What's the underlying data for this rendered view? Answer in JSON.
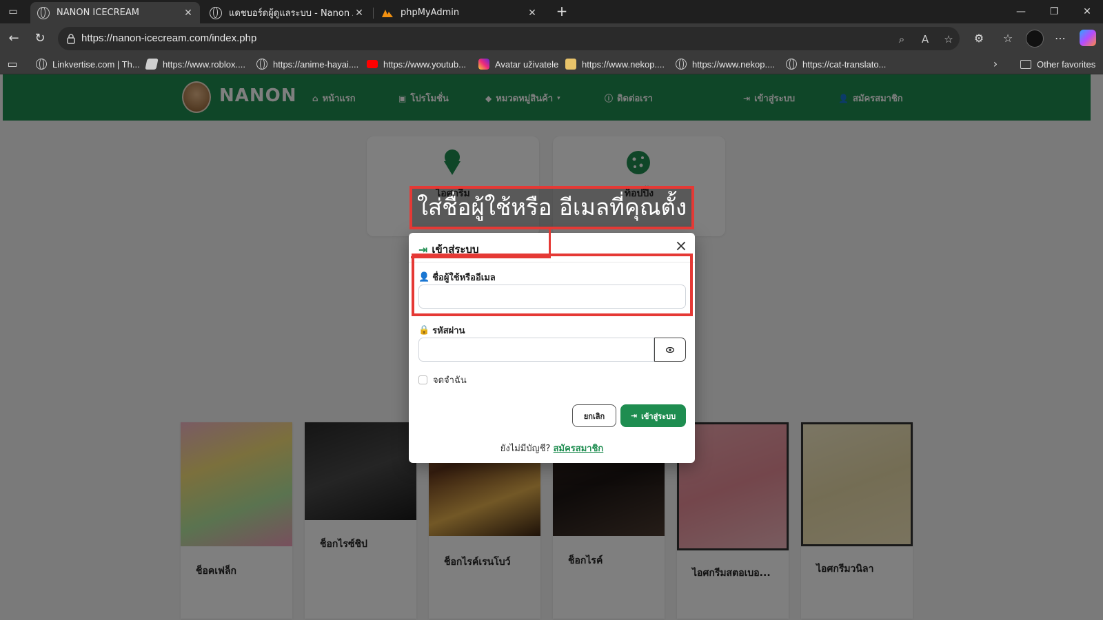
{
  "browser": {
    "tabs": [
      {
        "title": "NANON ICECREAM",
        "active": true
      },
      {
        "title": "แดชบอร์ดผู้ดูแลระบบ - Nanon Admin",
        "active": false
      },
      {
        "title": "phpMyAdmin",
        "active": false
      }
    ],
    "url": "https://nanon-icecream.com/index.php",
    "bookmarks": [
      {
        "label": "Linkvertise.com | Th...",
        "icon": "globe-icon"
      },
      {
        "label": "https://www.roblox....",
        "icon": "roblox-icon"
      },
      {
        "label": "https://anime-hayai....",
        "icon": "globe-icon"
      },
      {
        "label": "https://www.youtub...",
        "icon": "youtube-icon"
      },
      {
        "label": "Avatar uživatele",
        "icon": "instagram-icon"
      },
      {
        "label": "https://www.nekop....",
        "icon": "cat-icon"
      },
      {
        "label": "https://www.nekop....",
        "icon": "globe-icon"
      },
      {
        "label": "https://cat-translato...",
        "icon": "globe-icon"
      }
    ],
    "other_favorites": "Other favorites"
  },
  "site": {
    "brand": "NANON",
    "nav": [
      {
        "label": "หน้าแรก",
        "icon": "home-icon"
      },
      {
        "label": "โปรโมชั่น",
        "icon": "gift-icon"
      },
      {
        "label": "หมวดหมู่สินค้า",
        "icon": "tag-icon"
      },
      {
        "label": "ติดต่อเรา",
        "icon": "info-icon"
      },
      {
        "label": "เข้าสู่ระบบ",
        "icon": "sign-in-icon"
      },
      {
        "label": "สมัครสมาชิก",
        "icon": "user-plus-icon"
      }
    ],
    "categories": [
      {
        "label": "ไอศกรีม",
        "icon": "ice-cream-icon"
      },
      {
        "label": "ท็อปปิ้ง",
        "icon": "cookie-icon"
      }
    ],
    "products": [
      {
        "name": "ช็อคเฟล็ก"
      },
      {
        "name": "ช็อกไรซ์ชิป"
      },
      {
        "name": "ช็อกไรค์เรนโบว์"
      },
      {
        "name": "ช็อกไรค์"
      },
      {
        "name": "ไอศกรีมสตอเบอ..."
      },
      {
        "name": "ไอศกรีมวนิลา"
      }
    ]
  },
  "login_modal": {
    "title": "เข้าสู่ระบบ",
    "username_label": "ชื่อผู้ใช้หรืออีเมล",
    "username_value": "",
    "password_label": "รหัสผ่าน",
    "password_value": "",
    "remember_label": "จดจำฉัน",
    "remember_checked": false,
    "cancel_label": "ยกเลิก",
    "login_label": "เข้าสู่ระบบ",
    "no_account_text": "ยังไม่มีบัญชี?",
    "register_link": "สมัครสมาชิก"
  },
  "annotation": {
    "callout_text": "ใส่ชื่อผู้ใช้หรือ อีเมลที่คุณตั้ง",
    "color": "#e53935"
  },
  "colors": {
    "brand_green": "#1e8d50",
    "browser_dark": "#1f1f1f",
    "browser_toolbar": "#3a3a3a"
  }
}
